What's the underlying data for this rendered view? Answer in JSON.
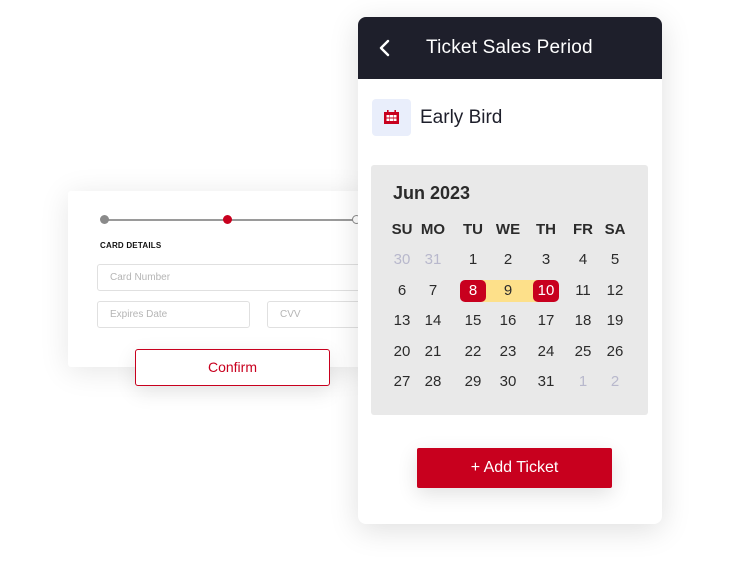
{
  "card_form": {
    "steps": [
      {
        "state": "completed"
      },
      {
        "state": "active"
      },
      {
        "state": "upcoming"
      }
    ],
    "section_label": "CARD DETAILS",
    "fields": {
      "card_number": {
        "placeholder": "Card Number",
        "value": ""
      },
      "expires_date": {
        "placeholder": "Expires Date",
        "value": ""
      },
      "cvv": {
        "placeholder": "CVV",
        "value": ""
      }
    },
    "confirm_label": "Confirm"
  },
  "panel": {
    "title": "Ticket Sales Period",
    "back_icon": "chevron-left-icon",
    "period": {
      "icon": "calendar-icon",
      "name": "Early Bird"
    },
    "calendar": {
      "month_label": "Jun 2023",
      "weekdays": [
        "SU",
        "MO",
        "TU",
        "WE",
        "TH",
        "FR",
        "SA"
      ],
      "weeks": [
        [
          {
            "d": "30",
            "muted": true
          },
          {
            "d": "31",
            "muted": true
          },
          {
            "d": "1"
          },
          {
            "d": "2"
          },
          {
            "d": "3"
          },
          {
            "d": "4"
          },
          {
            "d": "5"
          }
        ],
        [
          {
            "d": "6"
          },
          {
            "d": "7"
          },
          {
            "d": "8",
            "selected": true
          },
          {
            "d": "9",
            "in_range": true
          },
          {
            "d": "10",
            "selected": true
          },
          {
            "d": "11"
          },
          {
            "d": "12"
          }
        ],
        [
          {
            "d": "13"
          },
          {
            "d": "14"
          },
          {
            "d": "15"
          },
          {
            "d": "16"
          },
          {
            "d": "17"
          },
          {
            "d": "18"
          },
          {
            "d": "19"
          }
        ],
        [
          {
            "d": "20"
          },
          {
            "d": "21"
          },
          {
            "d": "22"
          },
          {
            "d": "23"
          },
          {
            "d": "24"
          },
          {
            "d": "25"
          },
          {
            "d": "26"
          }
        ],
        [
          {
            "d": "27"
          },
          {
            "d": "28"
          },
          {
            "d": "29"
          },
          {
            "d": "30"
          },
          {
            "d": "31"
          },
          {
            "d": "1",
            "muted": true
          },
          {
            "d": "2",
            "muted": true
          }
        ]
      ],
      "range_start": "8",
      "range_end": "10"
    },
    "add_ticket_label": "+ Add Ticket"
  },
  "colors": {
    "accent": "#c8001e",
    "header_bg": "#1e1f2b",
    "range_fill": "#fde08a",
    "calendar_bg": "#e9e9e9",
    "icon_bg": "#e9eefb"
  }
}
